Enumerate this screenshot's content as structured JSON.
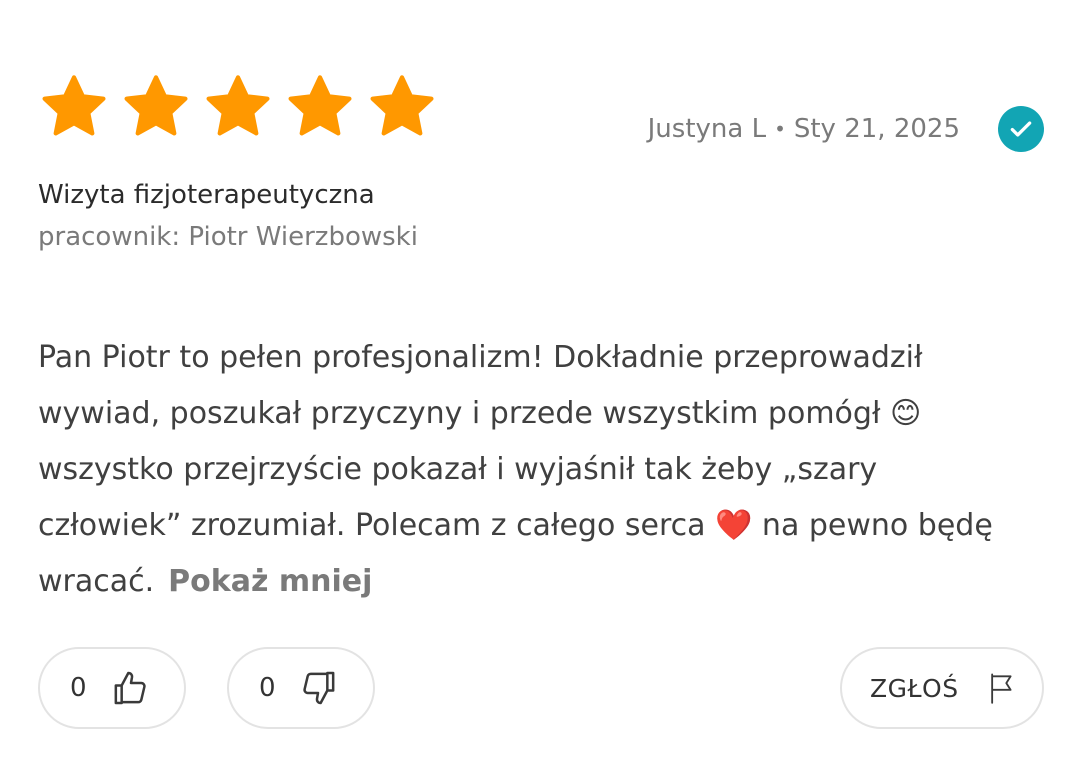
{
  "rating": {
    "stars": 5,
    "max": 5,
    "color": "#ff9800"
  },
  "author": {
    "name": "Justyna L",
    "separator": "•",
    "date": "Sty 21, 2025",
    "verified_color": "#12a5b4"
  },
  "service": {
    "name": "Wizyta fizjoterapeutyczna",
    "employee": "pracownik: Piotr Wierzbowski"
  },
  "review": {
    "text": "Pan Piotr to pełen profesjonalizm! Dokładnie przeprowadził wywiad, poszukał przyczyny i przede wszystkim pomógł 😊 wszystko przejrzyście pokazał i wyjaśnił tak żeby „szary człowiek” zrozumiał. Polecam z całego serca ❤️ na pewno będę wracać.",
    "toggle_label": "Pokaż mniej"
  },
  "actions": {
    "likes": "0",
    "dislikes": "0",
    "report_label": "ZGŁOŚ"
  },
  "icons": {
    "star": "star-icon",
    "verified": "checkmark-icon",
    "like": "thumbs-up-icon",
    "dislike": "thumbs-down-icon",
    "report": "flag-icon"
  }
}
